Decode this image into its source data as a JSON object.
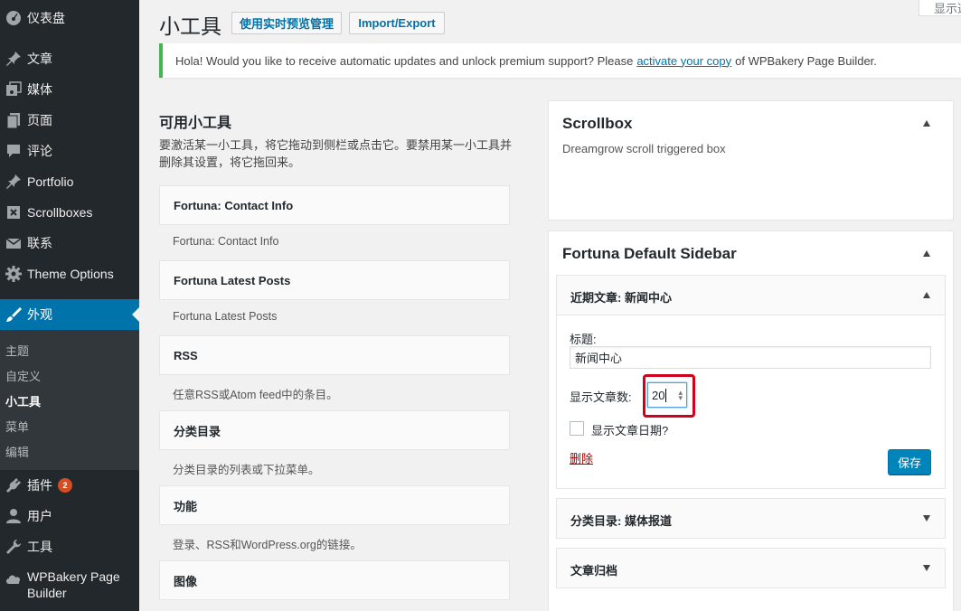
{
  "menu": {
    "items": [
      {
        "label": "仪表盘",
        "icon": "dashboard-icon"
      },
      {
        "label": "文章",
        "icon": "pin-icon"
      },
      {
        "label": "媒体",
        "icon": "media-icon"
      },
      {
        "label": "页面",
        "icon": "page-icon"
      },
      {
        "label": "评论",
        "icon": "comment-icon"
      },
      {
        "label": "Portfolio",
        "icon": "pin-icon"
      },
      {
        "label": "Scrollboxes",
        "icon": "scrollbox-icon"
      },
      {
        "label": "联系",
        "icon": "mail-icon"
      },
      {
        "label": "Theme Options",
        "icon": "gear-icon"
      },
      {
        "label": "外观",
        "icon": "brush-icon"
      },
      {
        "label": "插件",
        "icon": "plugin-icon",
        "badge": "2"
      },
      {
        "label": "用户",
        "icon": "user-icon"
      },
      {
        "label": "工具",
        "icon": "wrench-icon"
      },
      {
        "label": "WPBakery Page Builder",
        "icon": "cloud-icon"
      }
    ],
    "submenu": [
      "主题",
      "自定义",
      "小工具",
      "菜单",
      "编辑"
    ]
  },
  "header": {
    "title": "小工具",
    "live_preview_button": "使用实时预览管理",
    "import_export_button": "Import/Export",
    "screen_options": "显示选项"
  },
  "notice": {
    "text_before": "Hola! Would you like to receive automatic updates and unlock premium support? Please",
    "link": "activate your copy",
    "text_after": "of WPBakery Page Builder."
  },
  "available": {
    "title": "可用小工具",
    "description": "要激活某一小工具，将它拖动到侧栏或点击它。要禁用某一小工具并删除其设置，将它拖回来。",
    "widgets": [
      {
        "name": "Fortuna: Contact Info",
        "desc": "Fortuna: Contact Info"
      },
      {
        "name": "Fortuna Latest Posts",
        "desc": "Fortuna Latest Posts"
      },
      {
        "name": "RSS",
        "desc": "任意RSS或Atom feed中的条目。"
      },
      {
        "name": "分类目录",
        "desc": "分类目录的列表或下拉菜单。"
      },
      {
        "name": "功能",
        "desc": "登录、RSS和WordPress.org的链接。"
      },
      {
        "name": "图像",
        "desc": ""
      }
    ]
  },
  "scrollbox": {
    "title": "Scrollbox",
    "description": "Dreamgrow scroll triggered box"
  },
  "default_sidebar": {
    "title": "Fortuna Default Sidebar",
    "recent_posts": {
      "title": "近期文章: 新闻中心",
      "title_label": "标题:",
      "title_value": "新闻中心",
      "count_label": "显示文章数:",
      "count_value": "20",
      "show_date_label": "显示文章日期?",
      "show_date_checked": false,
      "delete_label": "删除",
      "save_label": "保存"
    },
    "categories_widget": "分类目录: 媒体报道",
    "archives_widget": "文章归档"
  }
}
